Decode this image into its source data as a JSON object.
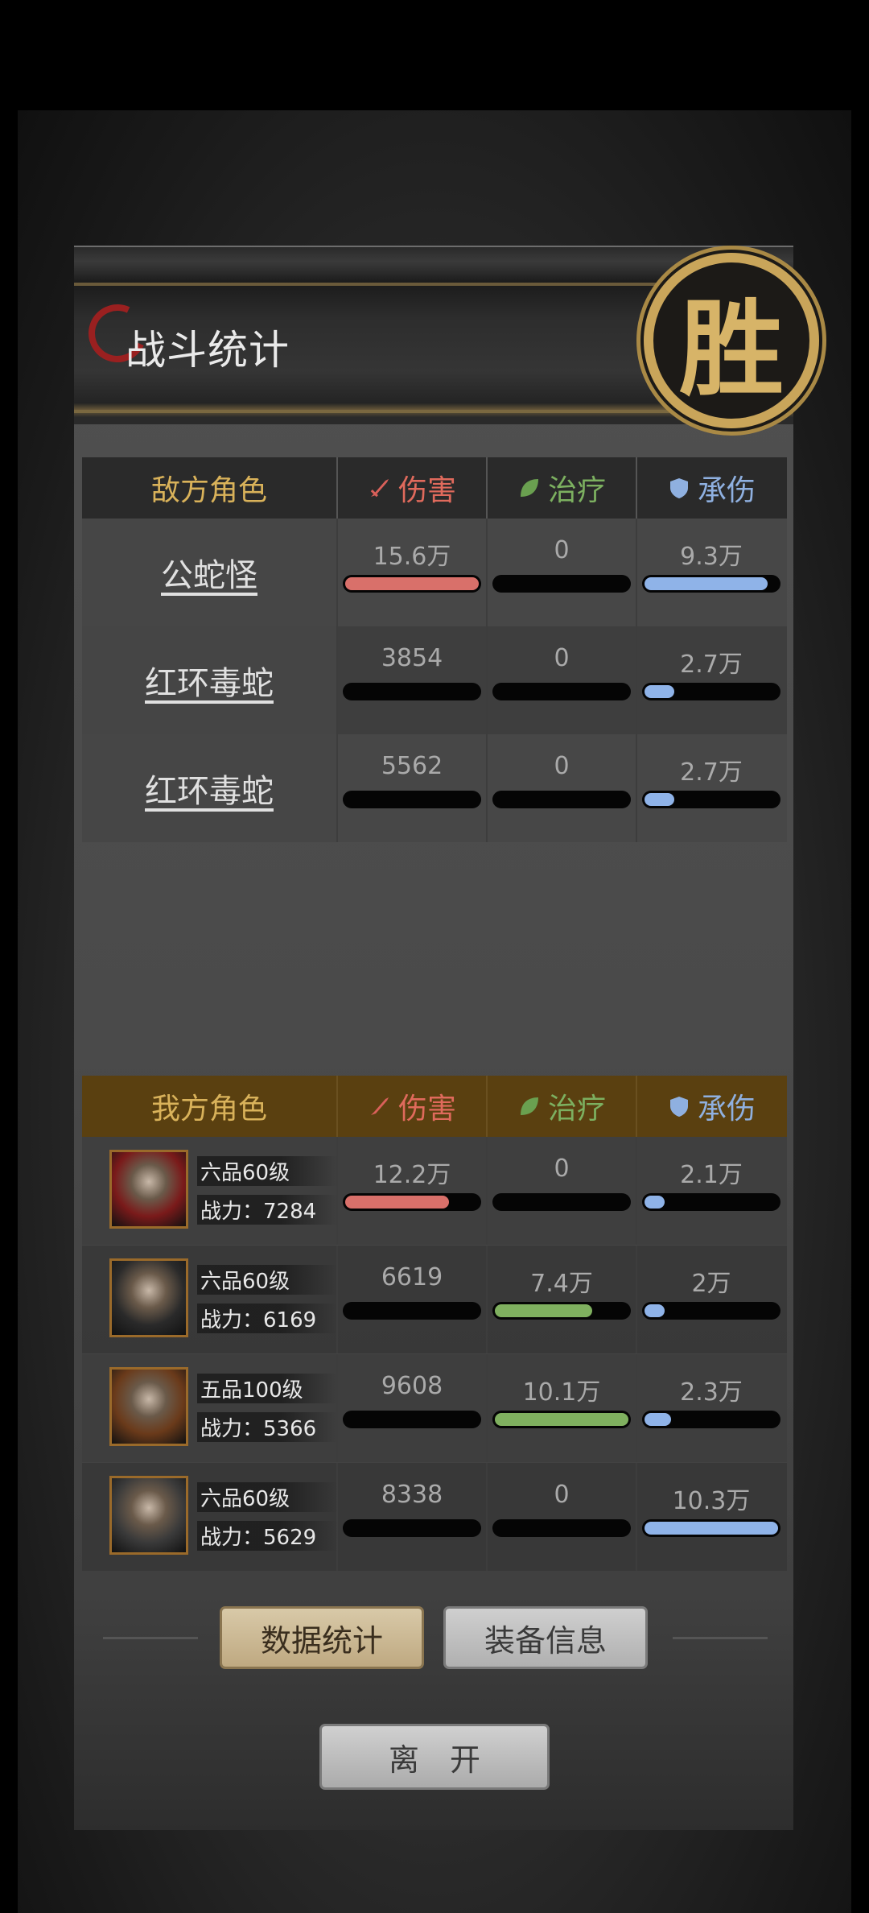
{
  "title": "战斗统计",
  "seal_char": "胜",
  "columns": {
    "damage": "伤害",
    "heal": "治疗",
    "tank": "承伤"
  },
  "enemy": {
    "header": "敌方角色",
    "rows": [
      {
        "name": "公蛇怪",
        "damage": "15.6万",
        "heal": "0",
        "tank": "9.3万",
        "damage_frac": 1.0,
        "heal_frac": 0,
        "tank_frac": 0.92
      },
      {
        "name": "红环毒蛇",
        "damage": "3854",
        "heal": "0",
        "tank": "2.7万",
        "damage_frac": 0,
        "heal_frac": 0,
        "tank_frac": 0.22
      },
      {
        "name": "红环毒蛇",
        "damage": "5562",
        "heal": "0",
        "tank": "2.7万",
        "damage_frac": 0,
        "heal_frac": 0,
        "tank_frac": 0.22
      }
    ]
  },
  "ally": {
    "header": "我方角色",
    "rows": [
      {
        "rank": "六品60级",
        "power": "战力：7284",
        "damage": "12.2万",
        "heal": "0",
        "tank": "2.1万",
        "damage_frac": 0.78,
        "heal_frac": 0,
        "tank_frac": 0.15,
        "avatar_color": "#7a1a1a"
      },
      {
        "rank": "六品60级",
        "power": "战力：6169",
        "damage": "6619",
        "heal": "7.4万",
        "tank": "2万",
        "damage_frac": 0,
        "heal_frac": 0.73,
        "tank_frac": 0.15,
        "avatar_color": "#2a2a2a"
      },
      {
        "rank": "五品100级",
        "power": "战力：5366",
        "damage": "9608",
        "heal": "10.1万",
        "tank": "2.3万",
        "damage_frac": 0,
        "heal_frac": 1.0,
        "tank_frac": 0.2,
        "avatar_color": "#6a3a1a"
      },
      {
        "rank": "六品60级",
        "power": "战力：5629",
        "damage": "8338",
        "heal": "0",
        "tank": "10.3万",
        "damage_frac": 0,
        "heal_frac": 0,
        "tank_frac": 1.0,
        "avatar_color": "#3a3a3a"
      }
    ]
  },
  "buttons": {
    "stats": "数据统计",
    "equipment": "装备信息",
    "leave": "离　开"
  },
  "colors": {
    "gold": "#d9b25a",
    "damage": "#e06a5c",
    "heal": "#7cb060",
    "tank": "#8fb0e0"
  }
}
